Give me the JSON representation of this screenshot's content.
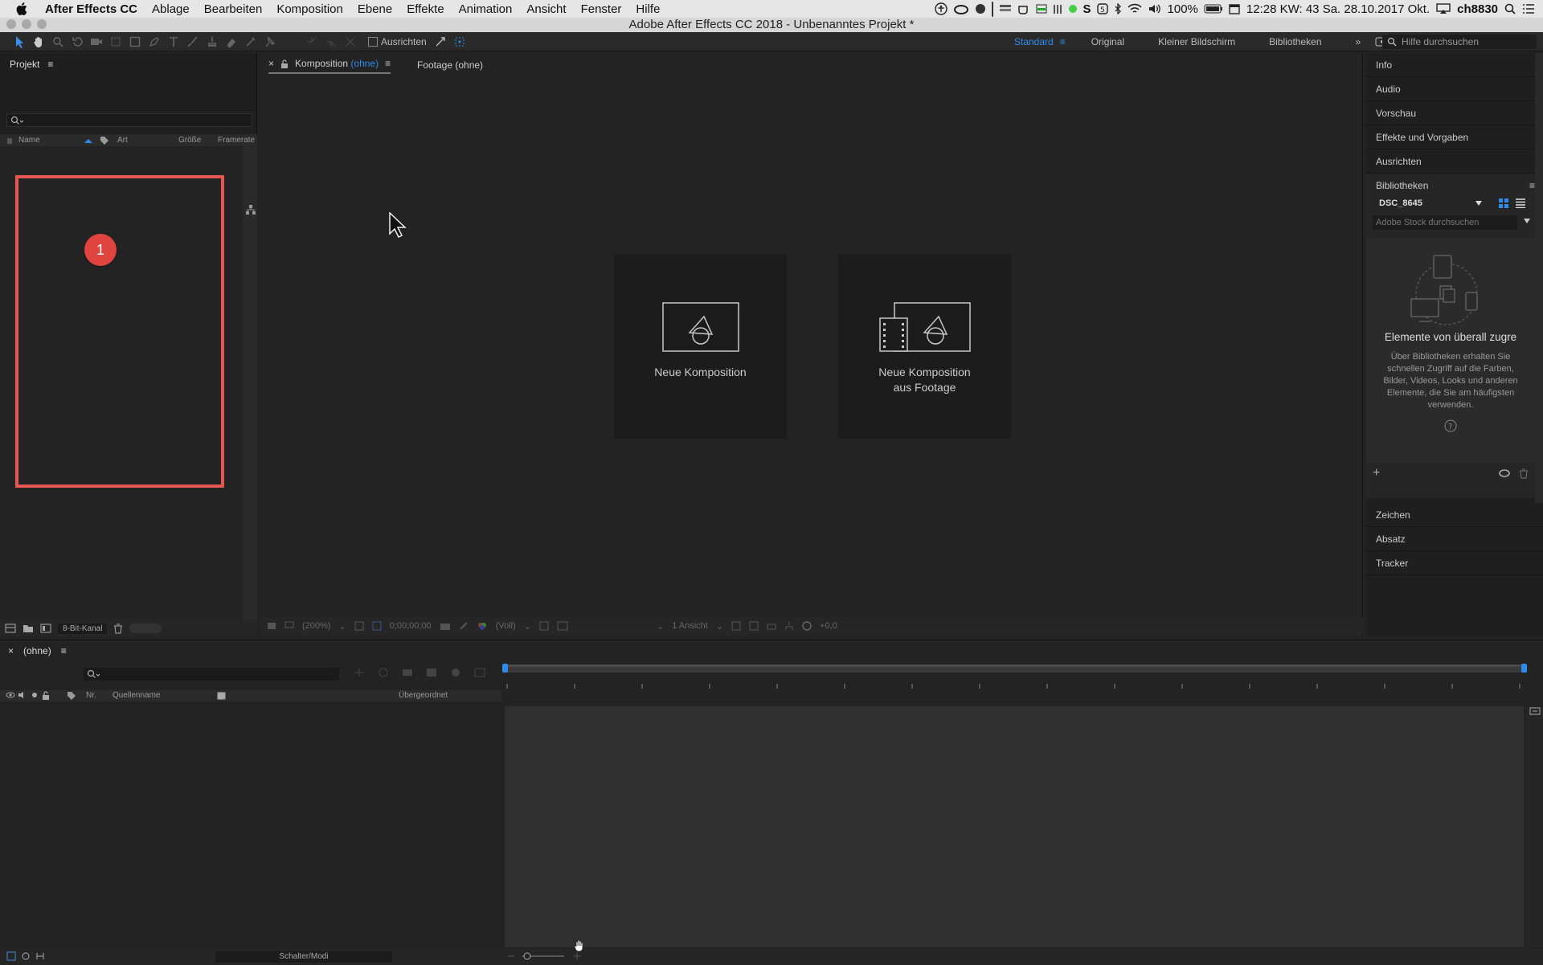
{
  "menubar": {
    "app": "After Effects CC",
    "items": [
      "Ablage",
      "Bearbeiten",
      "Komposition",
      "Ebene",
      "Effekte",
      "Animation",
      "Ansicht",
      "Fenster",
      "Hilfe"
    ],
    "battery": "100%",
    "clock": "12:28 KW: 43 Sa. 28.10.2017 Okt.",
    "user": "ch8830"
  },
  "window": {
    "title": "Adobe After Effects CC 2018 - Unbenanntes Projekt *"
  },
  "toolbar": {
    "align_label": "Ausrichten",
    "workspaces": [
      "Standard",
      "Original",
      "Kleiner Bildschirm",
      "Bibliotheken"
    ],
    "active_workspace": "Standard",
    "help_placeholder": "Hilfe durchsuchen"
  },
  "project": {
    "tab": "Projekt",
    "columns": [
      "Name",
      "Art",
      "Größe",
      "Framerate"
    ],
    "bit_depth": "8-Bit-Kanal",
    "annotation_number": "1"
  },
  "viewer": {
    "tab_prefix": "Komposition",
    "tab_value": "(ohne)",
    "tab_footage": "Footage (ohne)",
    "card_new_comp": "Neue Komposition",
    "card_from_footage_1": "Neue Komposition",
    "card_from_footage_2": "aus Footage",
    "zoom": "(200%)",
    "timecode": "0;00;00;00",
    "resolution": "(Voll)",
    "views": "1 Ansicht",
    "exposure": "+0,0"
  },
  "right_panel": {
    "items": [
      "Info",
      "Audio",
      "Vorschau",
      "Effekte und Vorgaben",
      "Ausrichten"
    ],
    "libraries_title": "Bibliotheken",
    "library_name": "DSC_8645",
    "stock_placeholder": "Adobe Stock durchsuchen",
    "empty_heading": "Elemente von überall zugre",
    "empty_text": "Über Bibliotheken erhalten Sie schnellen Zugriff auf die Farben, Bilder, Videos, Looks und anderen Elemente, die Sie am häufigsten verwenden.",
    "lower_items": [
      "Zeichen",
      "Absatz",
      "Tracker"
    ]
  },
  "timeline": {
    "tab": "(ohne)",
    "col_nr": "Nr.",
    "col_source": "Quellenname",
    "col_parent": "Übergeordnet",
    "switches": "Schalter/Modi"
  },
  "colors": {
    "accent": "#2d8ceb",
    "annotation": "#e3574e"
  }
}
